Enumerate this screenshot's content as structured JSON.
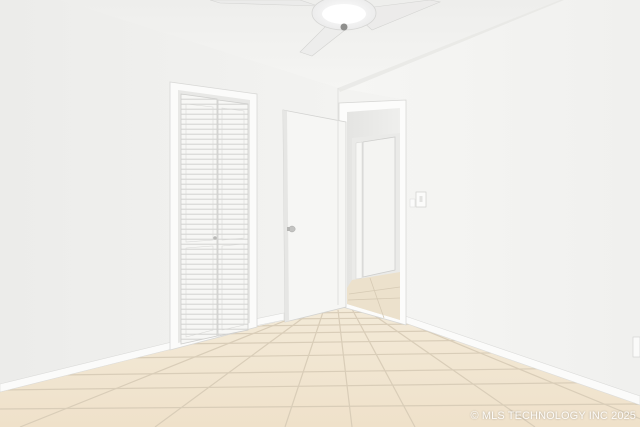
{
  "photo": {
    "watermark": "© MLS TECHNOLOGY INC 2025"
  },
  "colors": {
    "wall_left": "#f1f1ef",
    "wall_right": "#f4f4f2",
    "ceiling": "#f0f0ee",
    "tile": "#efe3d0",
    "grout": "#d6c9b4",
    "trim": "#ffffff",
    "door": "#f6f6f6"
  }
}
